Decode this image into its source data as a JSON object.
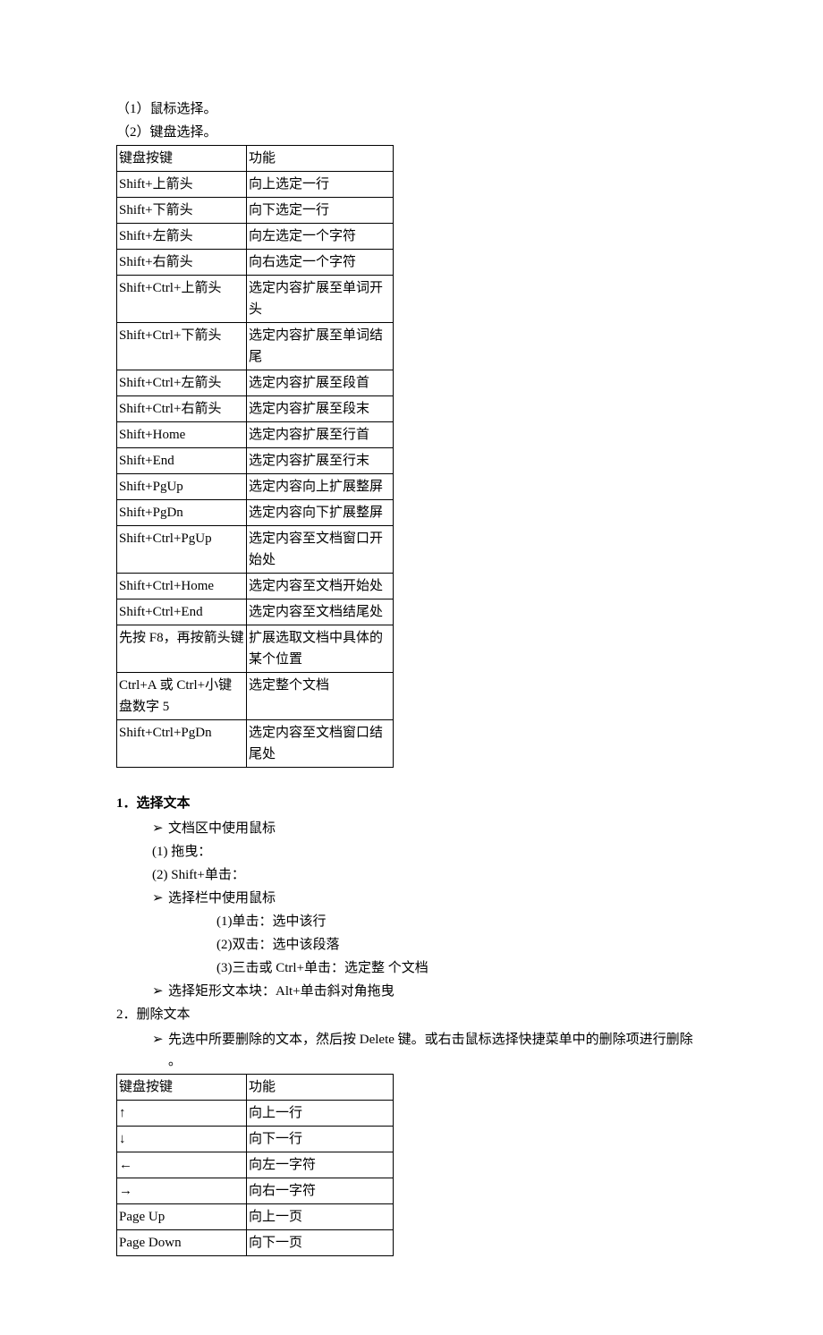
{
  "intro": {
    "line1": "（1）鼠标选择。",
    "line2": "（2）键盘选择。"
  },
  "shortcut_table": {
    "headers": [
      "键盘按键",
      "功能"
    ],
    "rows": [
      [
        "Shift+上箭头",
        "向上选定一行"
      ],
      [
        "Shift+下箭头",
        "向下选定一行"
      ],
      [
        "Shift+左箭头",
        "向左选定一个字符"
      ],
      [
        "Shift+右箭头",
        "向右选定一个字符"
      ],
      [
        "Shift+Ctrl+上箭头",
        "选定内容扩展至单词开头"
      ],
      [
        "Shift+Ctrl+下箭头",
        "选定内容扩展至单词结尾"
      ],
      [
        "Shift+Ctrl+左箭头",
        "选定内容扩展至段首"
      ],
      [
        "Shift+Ctrl+右箭头",
        "选定内容扩展至段末"
      ],
      [
        "Shift+Home",
        "选定内容扩展至行首"
      ],
      [
        "Shift+End",
        "选定内容扩展至行末"
      ],
      [
        "Shift+PgUp",
        "选定内容向上扩展整屏"
      ],
      [
        "Shift+PgDn",
        "选定内容向下扩展整屏"
      ],
      [
        "Shift+Ctrl+PgUp",
        "选定内容至文档窗口开始处"
      ],
      [
        "Shift+Ctrl+Home",
        "选定内容至文档开始处"
      ],
      [
        "Shift+Ctrl+End",
        "选定内容至文档结尾处"
      ],
      [
        "先按 F8，再按箭头键",
        "扩展选取文档中具体的某个位置"
      ],
      [
        "Ctrl+A 或 Ctrl+小键盘数字 5",
        "选定整个文档"
      ],
      [
        "Shift+Ctrl+PgDn",
        "选定内容至文档窗口结尾处"
      ]
    ]
  },
  "section1": {
    "heading": "1．选择文本",
    "bullets": {
      "b1": "文档区中使用鼠标",
      "n1": "(1)  拖曳：",
      "n2": "(2)  Shift+单击：",
      "b2": "选择栏中使用鼠标",
      "sub1": "(1)单击：选中该行",
      "sub2": "(2)双击：选中该段落",
      "sub3": "(3)三击或 Ctrl+单击：选定整  个文档",
      "b3": "选择矩形文本块：Alt+单击斜对角拖曳"
    }
  },
  "section2": {
    "heading": "2．删除文本",
    "b1": "先选中所要删除的文本，然后按 Delete 键。或右击鼠标选择快捷菜单中的删除项进行删除  。"
  },
  "nav_table": {
    "headers": [
      "键盘按键",
      "功能"
    ],
    "rows": [
      [
        "↑",
        "向上一行"
      ],
      [
        "↓",
        "向下一行"
      ],
      [
        "←",
        "向左一字符"
      ],
      [
        "→",
        "向右一字符"
      ],
      [
        "Page Up",
        "向上一页"
      ],
      [
        "Page Down",
        "向下一页"
      ]
    ]
  },
  "bullet_symbol": "➢"
}
